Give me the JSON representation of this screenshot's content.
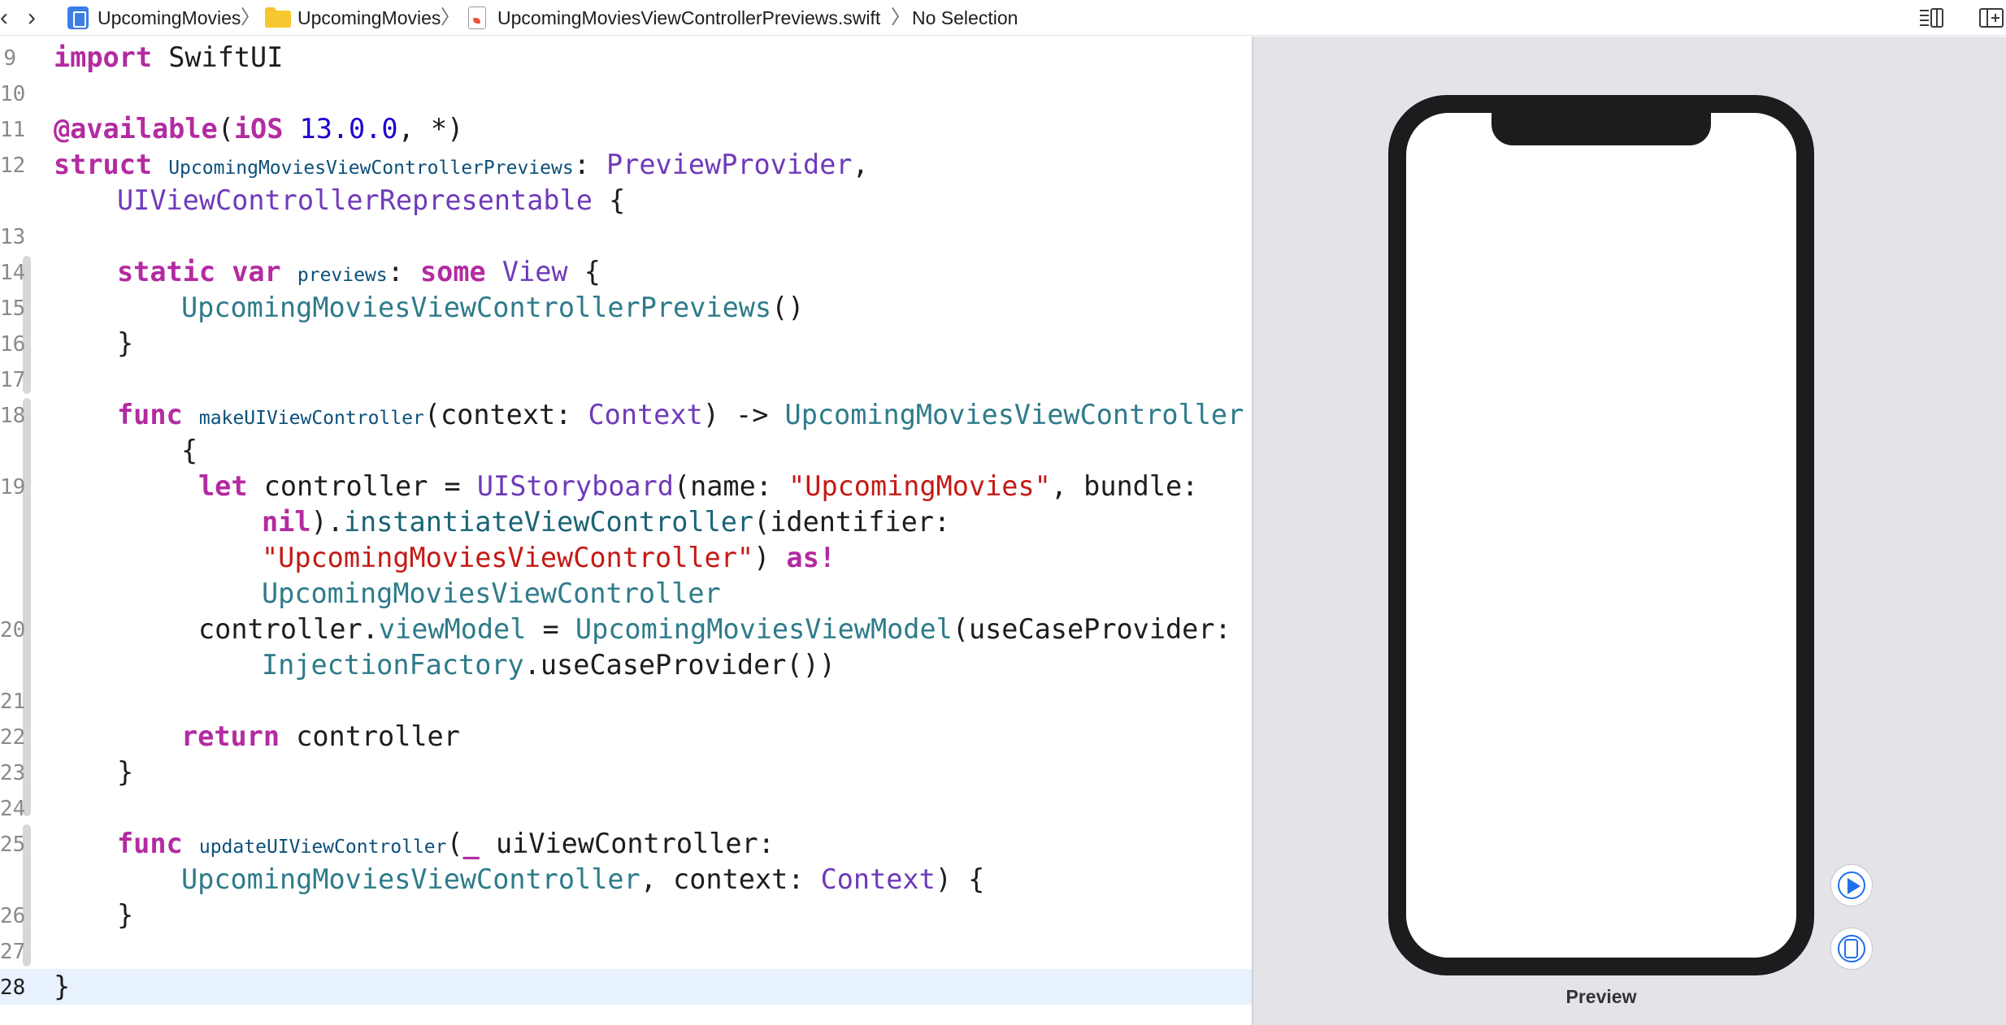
{
  "breadcrumb": {
    "back_icon": "chevron-left-icon",
    "forward_icon": "chevron-right-icon",
    "project": "UpcomingMovies",
    "folder": "UpcomingMovies",
    "file": "UpcomingMoviesViewControllerPreviews.swift",
    "selection": "No Selection",
    "separator": "〉"
  },
  "editor": {
    "current_line": "28",
    "line_numbers": [
      "9",
      "10",
      "11",
      "12",
      "13",
      "14",
      "15",
      "16",
      "17",
      "18",
      "19",
      "20",
      "21",
      "22",
      "23",
      "24",
      "25",
      "26",
      "27",
      "28"
    ],
    "code": {
      "l9": [
        "import",
        "SwiftUI"
      ],
      "l11": [
        "@available",
        "(",
        "iOS",
        "13.0.0",
        ", *)"
      ],
      "l12": [
        "struct",
        "UpcomingMoviesViewControllerPreviews",
        ":",
        "PreviewProvider",
        ","
      ],
      "l12b": [
        "UIViewControllerRepresentable",
        "{"
      ],
      "l14": [
        "static",
        "var",
        "previews",
        ":",
        "some",
        "View",
        "{"
      ],
      "l15": [
        "UpcomingMoviesViewControllerPreviews",
        "()"
      ],
      "l16": [
        "}"
      ],
      "l18": [
        "func",
        "makeUIViewController",
        "(context: ",
        "Context",
        ") -> ",
        "UpcomingMoviesViewController"
      ],
      "l18b": [
        "{"
      ],
      "l19": [
        "let",
        "controller = ",
        "UIStoryboard",
        "(name: ",
        "\"UpcomingMovies\"",
        ", bundle:"
      ],
      "l19b": [
        "nil",
        ").",
        "instantiateViewController",
        "(identifier:"
      ],
      "l19c": [
        "\"UpcomingMoviesViewController\"",
        ") ",
        "as!"
      ],
      "l19d": [
        "UpcomingMoviesViewController"
      ],
      "l20": [
        "controller.",
        "viewModel",
        " = ",
        "UpcomingMoviesViewModel",
        "(useCaseProvider:"
      ],
      "l20b": [
        "InjectionFactory",
        ".useCaseProvider())"
      ],
      "l22": [
        "return",
        "controller"
      ],
      "l23": [
        "}"
      ],
      "l25": [
        "func",
        "updateUIViewController",
        "(",
        "_",
        " uiViewController:"
      ],
      "l25b": [
        "UpcomingMoviesViewController",
        ", context: ",
        "Context",
        ") {"
      ],
      "l26": [
        "}"
      ],
      "l28": [
        "}"
      ]
    }
  },
  "canvas": {
    "preview_label": "Preview",
    "live_preview_icon": "play-circle-icon",
    "device_preview_icon": "device-circle-icon",
    "right_icons": [
      "inspector-toggle-icon",
      "add-editor-icon"
    ]
  },
  "colors": {
    "keyword": "#b32ba1",
    "type": "#6f3ab9",
    "project_type": "#2e7b8a",
    "string": "#c41a16",
    "number": "#1c00cf",
    "accent": "#1f6feb",
    "current_line": "#e8f2ff",
    "canvas_bg": "#e3e3e8"
  }
}
